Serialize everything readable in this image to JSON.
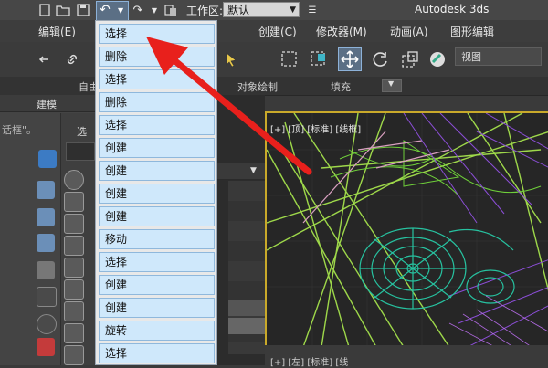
{
  "titlebar": {
    "workspace_label": "工作区:",
    "workspace_value": "默认",
    "app_title": "Autodesk 3ds"
  },
  "menubar": {
    "items": [
      "编辑(E)",
      "创建(C)",
      "修改器(M)",
      "动画(A)",
      "图形编辑"
    ]
  },
  "toolbar": {
    "view_select": "视图"
  },
  "ribbon": {
    "items": [
      "自由",
      "对象绘制",
      "填充"
    ]
  },
  "left": {
    "mode_label": "建模",
    "dialog_text": "话框\"。",
    "select_label": "选择"
  },
  "viewport": {
    "label": "[+] [顶] [标准] [线框]",
    "bottom_label": "[+] [左] [标准] [线"
  },
  "history": {
    "items": [
      "选择",
      "删除",
      "选择",
      "删除",
      "选择",
      "创建",
      "创建",
      "创建",
      "创建",
      "移动",
      "选择",
      "创建",
      "创建",
      "旋转",
      "选择"
    ]
  },
  "colors": {
    "list_item_bg": "#cfe8fb",
    "list_item_border": "#8fb8dc",
    "arrow": "#e8201c",
    "viewport_border": "#c9a92a"
  }
}
